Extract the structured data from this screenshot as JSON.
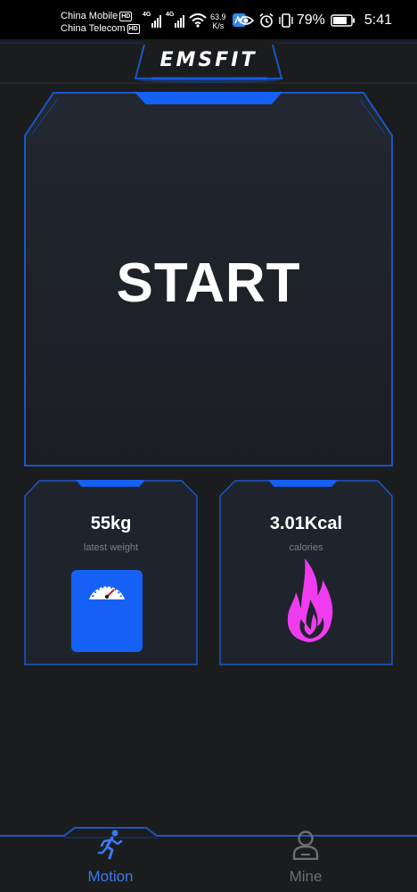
{
  "status_bar": {
    "carrier_1": "China Mobile",
    "carrier_2": "China Telecom",
    "hd_badge": "HD",
    "network_1": "4G",
    "network_2": "4G",
    "net_speed_value": "63.9",
    "net_speed_unit": "K/s",
    "battery_percent": "79%",
    "time": "5:41"
  },
  "header": {
    "brand": "EMSFIT"
  },
  "start_panel": {
    "label": "START"
  },
  "weight_card": {
    "value": "55kg",
    "caption": "latest weight"
  },
  "calories_card": {
    "value": "3.01Kcal",
    "caption": "calories"
  },
  "bottom_nav": {
    "items": [
      {
        "label": "Motion",
        "icon": "running-icon",
        "active": true
      },
      {
        "label": "Mine",
        "icon": "user-icon",
        "active": false
      }
    ]
  },
  "colors": {
    "background": "#1b1c1e",
    "accent_blue": "#1560f5",
    "border_blue": "#1a56c8",
    "active_tab": "#3a7bf0",
    "inactive_tab": "#6c6f74",
    "flame": "#f03cf0"
  }
}
